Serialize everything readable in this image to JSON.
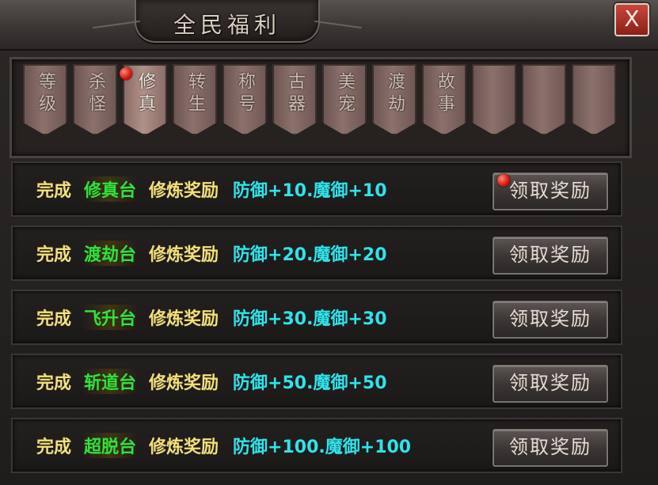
{
  "window": {
    "title": "全民福利",
    "close_label": "X"
  },
  "tabs": [
    {
      "label": "等级",
      "active": false,
      "badge": false
    },
    {
      "label": "杀怪",
      "active": false,
      "badge": false
    },
    {
      "label": "修真",
      "active": true,
      "badge": true
    },
    {
      "label": "转生",
      "active": false,
      "badge": false
    },
    {
      "label": "称号",
      "active": false,
      "badge": false
    },
    {
      "label": "古器",
      "active": false,
      "badge": false
    },
    {
      "label": "美宠",
      "active": false,
      "badge": false
    },
    {
      "label": "渡劫",
      "active": false,
      "badge": false
    },
    {
      "label": "故事",
      "active": false,
      "badge": false
    },
    {
      "label": "",
      "active": false,
      "badge": false
    },
    {
      "label": "",
      "active": false,
      "badge": false
    },
    {
      "label": "",
      "active": false,
      "badge": false
    }
  ],
  "rewards": [
    {
      "done": "完成",
      "place": "修真台",
      "label": "修炼奖励",
      "reward": "防御+10.魔御+10",
      "button": "领取奖励",
      "badge": true
    },
    {
      "done": "完成",
      "place": "渡劫台",
      "label": "修炼奖励",
      "reward": "防御+20.魔御+20",
      "button": "领取奖励",
      "badge": false
    },
    {
      "done": "完成",
      "place": "飞升台",
      "label": "修炼奖励",
      "reward": "防御+30.魔御+30",
      "button": "领取奖励",
      "badge": false
    },
    {
      "done": "完成",
      "place": "斩道台",
      "label": "修炼奖励",
      "reward": "防御+50.魔御+50",
      "button": "领取奖励",
      "badge": false
    },
    {
      "done": "完成",
      "place": "超脱台",
      "label": "修炼奖励",
      "reward": "防御+100.魔御+100",
      "button": "领取奖励",
      "badge": false
    }
  ],
  "colors": {
    "done_text": "#f3e07a",
    "place_text": "#2ee33a",
    "reward_text": "#2fe3ea",
    "badge": "#d5140c"
  }
}
